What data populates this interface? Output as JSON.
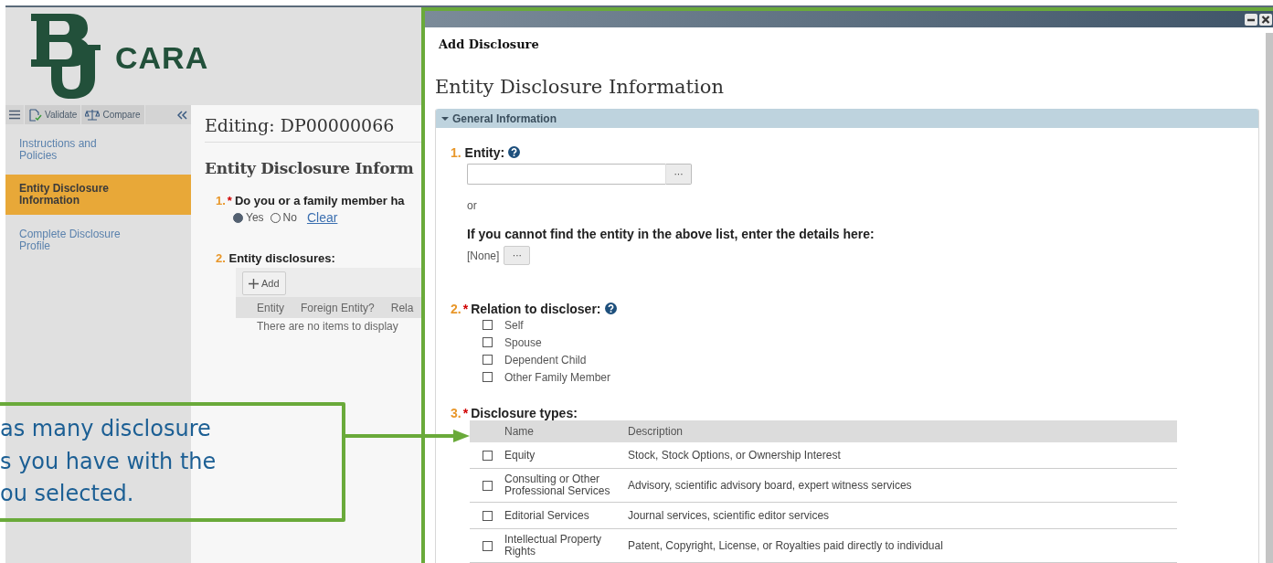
{
  "app": {
    "brand": "CARA",
    "toolbar": [
      {
        "label": "Validate",
        "kind": "validate"
      },
      {
        "label": "Compare",
        "kind": "compare"
      }
    ],
    "nav": [
      {
        "label": "Instructions and Policies",
        "selected": false
      },
      {
        "label": "Entity Disclosure Information",
        "selected": true
      },
      {
        "label": "Complete Disclosure Profile",
        "selected": false
      }
    ],
    "editing_title": "Editing: DP00000066",
    "section_title": "Entity Disclosure Inform",
    "q1": {
      "number": "1.",
      "required_mark": "*",
      "text": "Do you or a family member ha",
      "options": [
        {
          "label": "Yes",
          "selected": true
        },
        {
          "label": "No",
          "selected": false
        }
      ],
      "clear_link": "Clear"
    },
    "q2": {
      "number": "2.",
      "text": "Entity disclosures:",
      "add_button": "Add",
      "columns": [
        "Entity",
        "Foreign Entity?",
        "Rela"
      ],
      "empty_message": "There are no items to display"
    }
  },
  "dialog": {
    "title": "Add Disclosure",
    "heading": "Entity Disclosure Information",
    "panel": {
      "title": "General Information",
      "expanded": true
    },
    "q1": {
      "number": "1.",
      "label": "Entity:",
      "browse": "···",
      "or": "or",
      "alt_label": "If you cannot find the entity in the above list, enter the details here:",
      "alt_value": "[None]",
      "alt_browse": "···"
    },
    "q2": {
      "number": "2.",
      "required_mark": "*",
      "label": "Relation to discloser:",
      "options": [
        {
          "label": "Self",
          "checked": false
        },
        {
          "label": "Spouse",
          "checked": false
        },
        {
          "label": "Dependent Child",
          "checked": false
        },
        {
          "label": "Other Family Member",
          "checked": false
        }
      ]
    },
    "q3": {
      "number": "3.",
      "required_mark": "*",
      "label": "Disclosure types:",
      "columns": [
        "Name",
        "Description"
      ],
      "rows": [
        {
          "name": "Equity",
          "description": "Stock, Stock Options, or Ownership Interest",
          "checked": false
        },
        {
          "name": "Consulting or Other Professional Services",
          "description": "Advisory, scientific advisory board, expert witness services",
          "checked": false
        },
        {
          "name": "Editorial Services",
          "description": "Journal services, scientific editor services",
          "checked": false
        },
        {
          "name": "Intellectual Property Rights",
          "description": "Patent, Copyright, License, or Royalties paid directly to individual",
          "checked": false
        }
      ]
    }
  },
  "callout": {
    "lines": [
      "as many disclosure",
      "s you have with the",
      "ou selected."
    ]
  }
}
